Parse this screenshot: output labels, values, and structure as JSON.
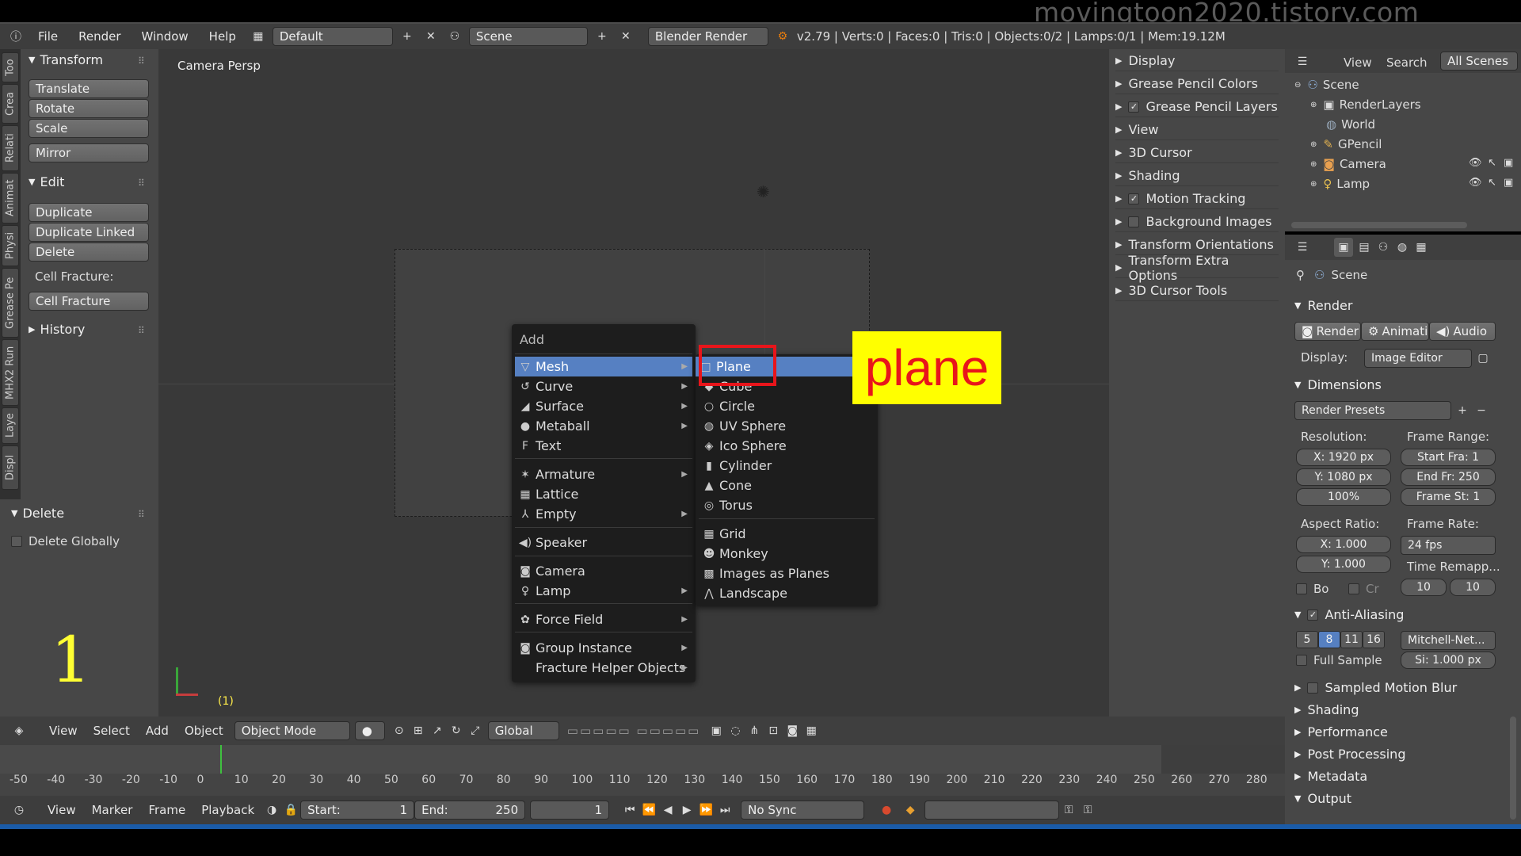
{
  "watermark": "movingtoon2020.tistory.com",
  "topbar": {
    "menus": [
      "File",
      "Render",
      "Window",
      "Help"
    ],
    "layout": "Default",
    "scene": "Scene",
    "engine": "Blender Render",
    "stats": "v2.79 | Verts:0 | Faces:0 | Tris:0 | Objects:0/2 | Lamps:0/1 | Mem:19.12M"
  },
  "left_tabs": [
    "Too",
    "Crea",
    "Relati",
    "Animat",
    "Physi",
    "Grease Pe",
    "MHX2 Run",
    "Laye",
    "Displ"
  ],
  "tool_panel": {
    "transform": "Transform",
    "translate": "Translate",
    "rotate": "Rotate",
    "scale": "Scale",
    "mirror": "Mirror",
    "edit": "Edit",
    "duplicate": "Duplicate",
    "duplicate_linked": "Duplicate Linked",
    "delete": "Delete",
    "cell_fracture_label": "Cell Fracture:",
    "cell_fracture": "Cell Fracture",
    "history": "History",
    "delete_head": "Delete",
    "delete_globally": "Delete Globally",
    "big_number": "1"
  },
  "viewport": {
    "label": "Camera Persp",
    "frame_indicator": "(1)"
  },
  "add_menu": {
    "title": "Add",
    "items": [
      {
        "label": "Mesh",
        "icon": "▽",
        "sub": true,
        "selected": true
      },
      {
        "label": "Curve",
        "icon": "↺",
        "sub": true
      },
      {
        "label": "Surface",
        "icon": "◢",
        "sub": true
      },
      {
        "label": "Metaball",
        "icon": "●",
        "sub": true
      },
      {
        "label": "Text",
        "icon": "F",
        "sub": false
      },
      {
        "label": "Armature",
        "icon": "✶",
        "sub": true
      },
      {
        "label": "Lattice",
        "icon": "▦",
        "sub": false
      },
      {
        "label": "Empty",
        "icon": "⅄",
        "sub": true
      },
      {
        "label": "Speaker",
        "icon": "◀)",
        "sub": false
      },
      {
        "label": "Camera",
        "icon": "◙",
        "sub": false
      },
      {
        "label": "Lamp",
        "icon": "♀",
        "sub": true
      },
      {
        "label": "Force Field",
        "icon": "✿",
        "sub": true
      },
      {
        "label": "Group Instance",
        "icon": "◙",
        "sub": true
      },
      {
        "label": "Fracture Helper Objects",
        "icon": "",
        "sub": true
      }
    ]
  },
  "mesh_menu": {
    "items": [
      {
        "label": "Plane",
        "icon": "□"
      },
      {
        "label": "Cube",
        "icon": "◆"
      },
      {
        "label": "Circle",
        "icon": "○"
      },
      {
        "label": "UV Sphere",
        "icon": "◍"
      },
      {
        "label": "Ico Sphere",
        "icon": "◈"
      },
      {
        "label": "Cylinder",
        "icon": "▮"
      },
      {
        "label": "Cone",
        "icon": "▲"
      },
      {
        "label": "Torus",
        "icon": "◎"
      },
      {
        "label": "Grid",
        "icon": "▦"
      },
      {
        "label": "Monkey",
        "icon": "☻"
      },
      {
        "label": "Images as Planes",
        "icon": "▩"
      },
      {
        "label": "Landscape",
        "icon": "⋀"
      }
    ]
  },
  "annotation": {
    "text": "plane",
    "bg": "#ffff00",
    "color": "#e8151b",
    "box_color": "#e8151b"
  },
  "right_panel": {
    "rows": [
      {
        "label": "Display",
        "check": null
      },
      {
        "label": "Grease Pencil Colors",
        "check": null
      },
      {
        "label": "Grease Pencil Layers",
        "check": true
      },
      {
        "label": "View",
        "check": null
      },
      {
        "label": "3D Cursor",
        "check": null
      },
      {
        "label": "Shading",
        "check": null
      },
      {
        "label": "Motion Tracking",
        "check": true
      },
      {
        "label": "Background Images",
        "check": false
      },
      {
        "label": "Transform Orientations",
        "check": null
      },
      {
        "label": "Transform Extra Options",
        "check": null
      },
      {
        "label": "3D Cursor Tools",
        "check": null
      }
    ]
  },
  "outliner": {
    "tabs": [
      "View",
      "Search",
      "All Scenes"
    ],
    "items": [
      {
        "label": "Scene",
        "indent": 0
      },
      {
        "label": "RenderLayers",
        "indent": 1
      },
      {
        "label": "World",
        "indent": 1
      },
      {
        "label": "GPencil",
        "indent": 1
      },
      {
        "label": "Camera",
        "indent": 1
      },
      {
        "label": "Lamp",
        "indent": 1
      }
    ]
  },
  "properties": {
    "scene": "Scene",
    "render": "Render",
    "render_btn": "Render",
    "anim_btn": "Animati",
    "audio_btn": "Audio",
    "display_label": "Display:",
    "display_value": "Image Editor",
    "dimensions": "Dimensions",
    "presets": "Render Presets",
    "resolution": "Resolution:",
    "res_x": "X:  1920 px",
    "res_y": "Y:  1080 px",
    "res_pct": "100%",
    "frame_range": "Frame Range:",
    "start": "Start Fra:  1",
    "end": "End Fr: 250",
    "step": "Frame St: 1",
    "aspect": "Aspect Ratio:",
    "asp_x": "X:     1.000",
    "asp_y": "Y:     1.000",
    "frame_rate": "Frame Rate:",
    "fps": "24 fps",
    "time_remap": "Time Remapp...",
    "remap_a": "10",
    "remap_b": "10",
    "bo": "Bo",
    "cr": "Cr",
    "aa": "Anti-Aliasing",
    "aa_values": [
      "5",
      "8",
      "11",
      "16"
    ],
    "filter": "Mitchell-Net...",
    "full_sample": "Full Sample",
    "size": "Si: 1.000 px",
    "smb": "Sampled Motion Blur",
    "shading": "Shading",
    "performance": "Performance",
    "post": "Post Processing",
    "metadata": "Metadata",
    "output": "Output"
  },
  "header3d": {
    "menus": [
      "View",
      "Select",
      "Add",
      "Object"
    ],
    "mode": "Object Mode",
    "orientation": "Global"
  },
  "ruler": [
    "-50",
    "-40",
    "-30",
    "-20",
    "-10",
    "0",
    "10",
    "20",
    "30",
    "40",
    "50",
    "60",
    "70",
    "80",
    "90",
    "100",
    "110",
    "120",
    "130",
    "140",
    "150",
    "160",
    "170",
    "180",
    "190",
    "200",
    "210",
    "220",
    "230",
    "240",
    "250",
    "260",
    "270",
    "280"
  ],
  "timeline_bar": {
    "menus": [
      "View",
      "Marker",
      "Frame",
      "Playback"
    ],
    "start": "Start:",
    "start_val": "1",
    "end": "End:",
    "end_val": "250",
    "current": "1",
    "sync": "No Sync"
  }
}
